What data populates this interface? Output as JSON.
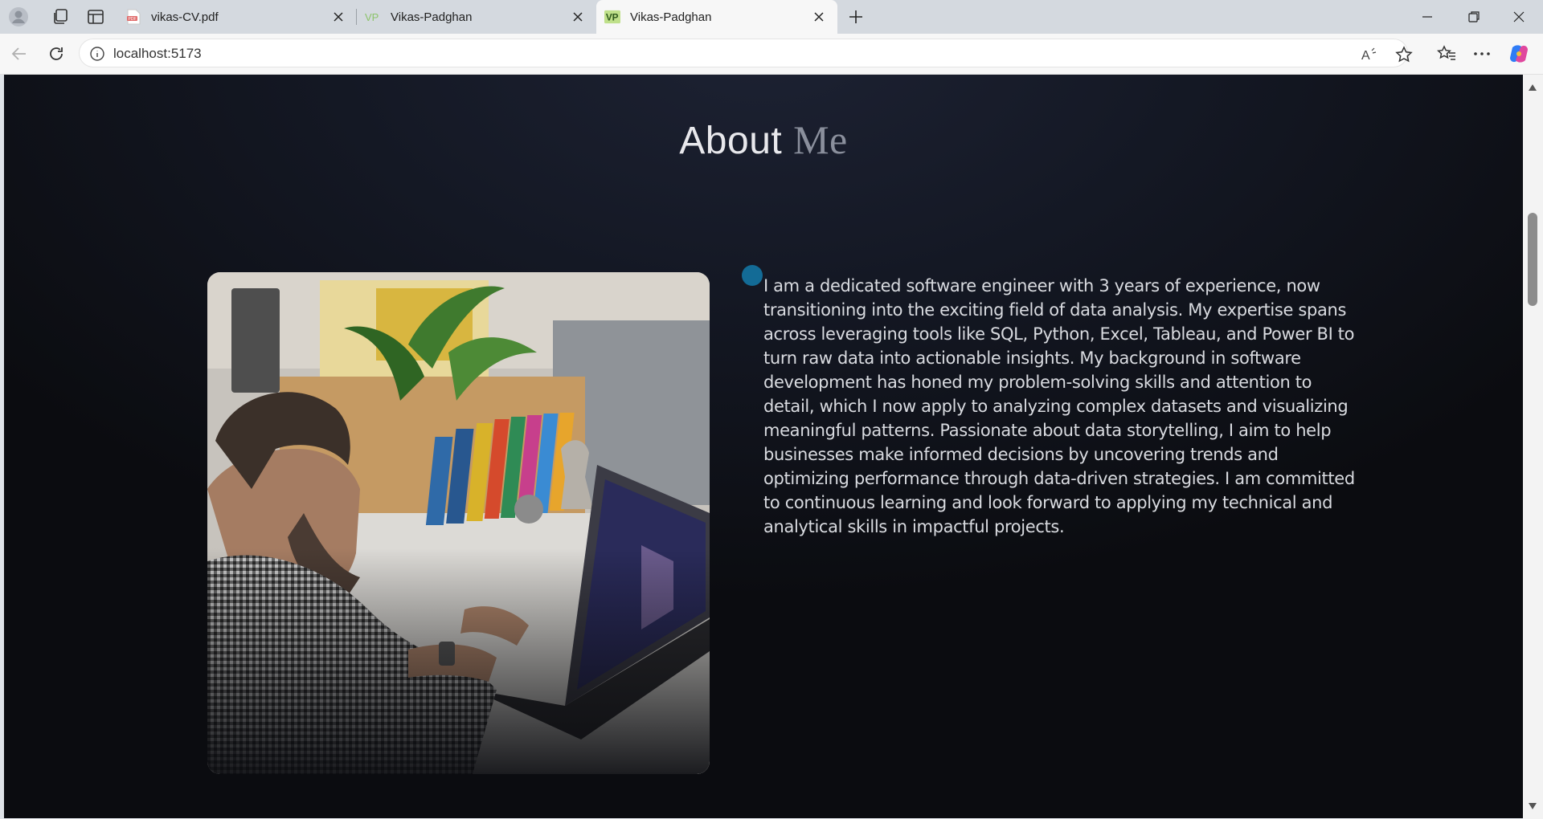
{
  "browser": {
    "tabs": [
      {
        "label": "vikas-CV.pdf",
        "favicon": "pdf-icon",
        "active": false
      },
      {
        "label": "Vikas-Padghan",
        "favicon": "vp-logo-icon",
        "active": false
      },
      {
        "label": "Vikas-Padghan",
        "favicon": "vp-logo-icon",
        "active": true
      }
    ],
    "favicon_text": "VP",
    "pdf_favicon_text": "PDF",
    "url": "localhost:5173"
  },
  "about": {
    "title_main": "About",
    "title_accent": "Me",
    "bio": "I am a dedicated software engineer with 3 years of experience, now transitioning into the exciting field of data analysis. My expertise spans across leveraging tools like SQL, Python, Excel, Tableau, and Power BI to turn raw data into actionable insights. My background in software development has honed my problem-solving skills and attention to detail, which I now apply to analyzing complex datasets and visualizing meaningful patterns. Passionate about data storytelling, I aim to help businesses make informed decisions by uncovering trends and optimizing performance through data-driven strategies. I am committed to continuous learning and look forward to applying my technical and analytical skills in impactful projects."
  },
  "colors": {
    "accent_dot": "#136b96",
    "page_bg": "#0b0c10",
    "title_accent": "#8a8f9c"
  }
}
